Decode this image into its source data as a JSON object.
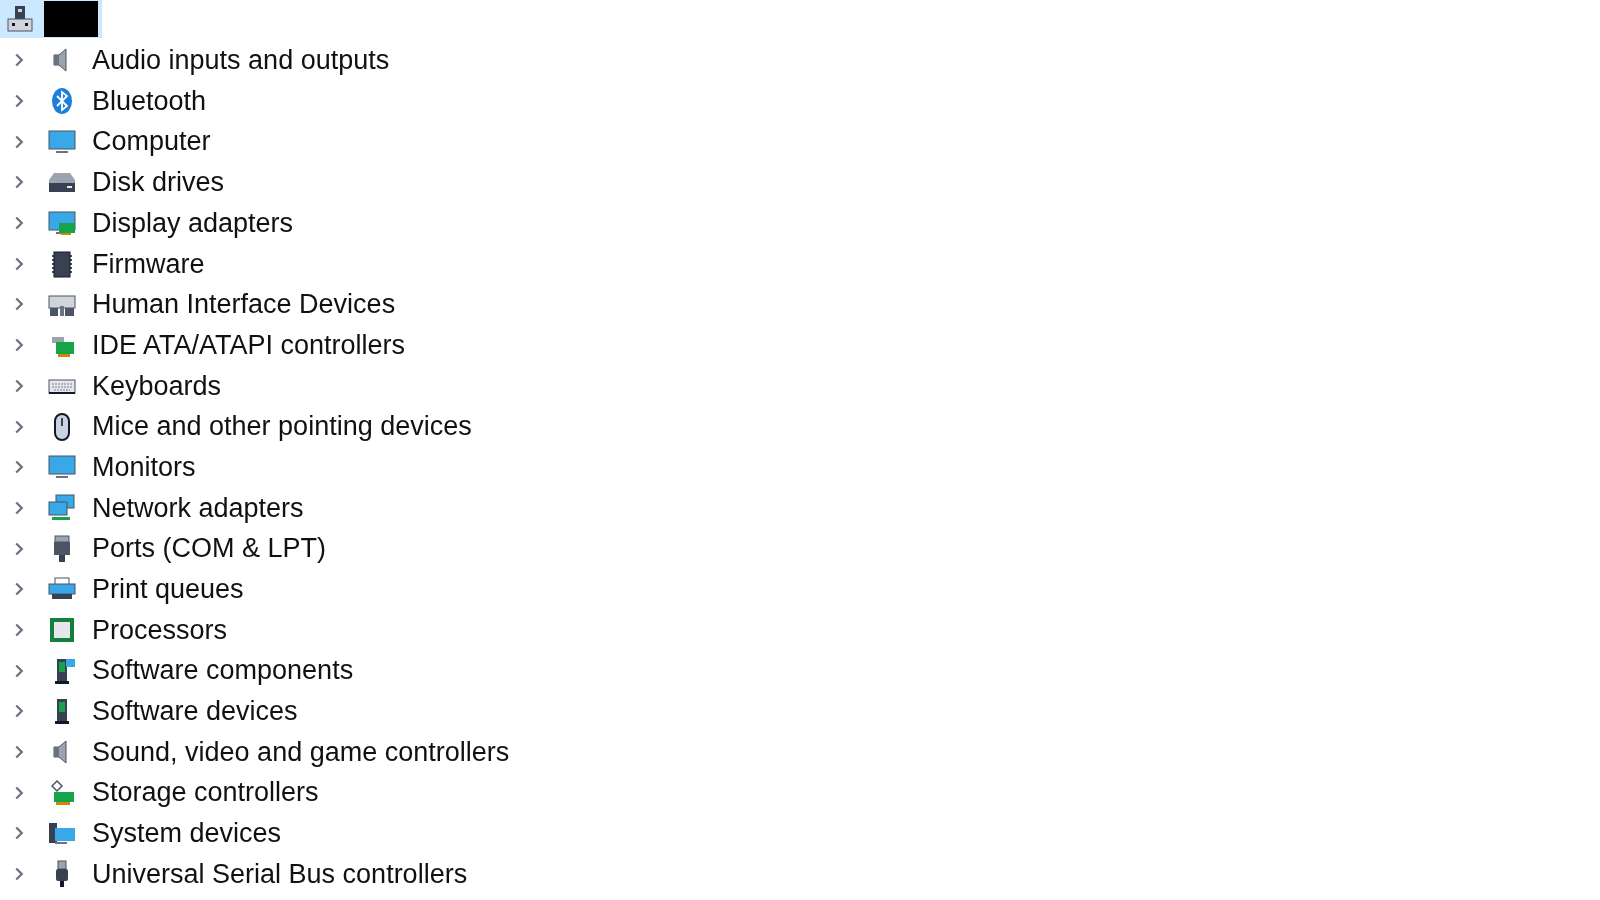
{
  "tree": {
    "root": {
      "selected": true,
      "name_redacted": true
    },
    "items": [
      {
        "label": "Audio inputs and outputs",
        "expanded": false,
        "selected": false
      },
      {
        "label": "Bluetooth",
        "expanded": false,
        "selected": false
      },
      {
        "label": "Computer",
        "expanded": false,
        "selected": false
      },
      {
        "label": "Disk drives",
        "expanded": false,
        "selected": false
      },
      {
        "label": "Display adapters",
        "expanded": false,
        "selected": false
      },
      {
        "label": "Firmware",
        "expanded": false,
        "selected": false
      },
      {
        "label": "Human Interface Devices",
        "expanded": false,
        "selected": false
      },
      {
        "label": "IDE ATA/ATAPI controllers",
        "expanded": false,
        "selected": false
      },
      {
        "label": "Keyboards",
        "expanded": false,
        "selected": false
      },
      {
        "label": "Mice and other pointing devices",
        "expanded": false,
        "selected": false
      },
      {
        "label": "Monitors",
        "expanded": false,
        "selected": false
      },
      {
        "label": "Network adapters",
        "expanded": false,
        "selected": false
      },
      {
        "label": "Ports (COM & LPT)",
        "expanded": false,
        "selected": false
      },
      {
        "label": "Print queues",
        "expanded": false,
        "selected": false
      },
      {
        "label": "Processors",
        "expanded": false,
        "selected": false
      },
      {
        "label": "Software components",
        "expanded": false,
        "selected": false
      },
      {
        "label": "Software devices",
        "expanded": false,
        "selected": false
      },
      {
        "label": "Sound, video and game controllers",
        "expanded": false,
        "selected": false
      },
      {
        "label": "Storage controllers",
        "expanded": false,
        "selected": false
      },
      {
        "label": "System devices",
        "expanded": false,
        "selected": false
      },
      {
        "label": "Universal Serial Bus controllers",
        "expanded": false,
        "selected": false
      }
    ]
  }
}
